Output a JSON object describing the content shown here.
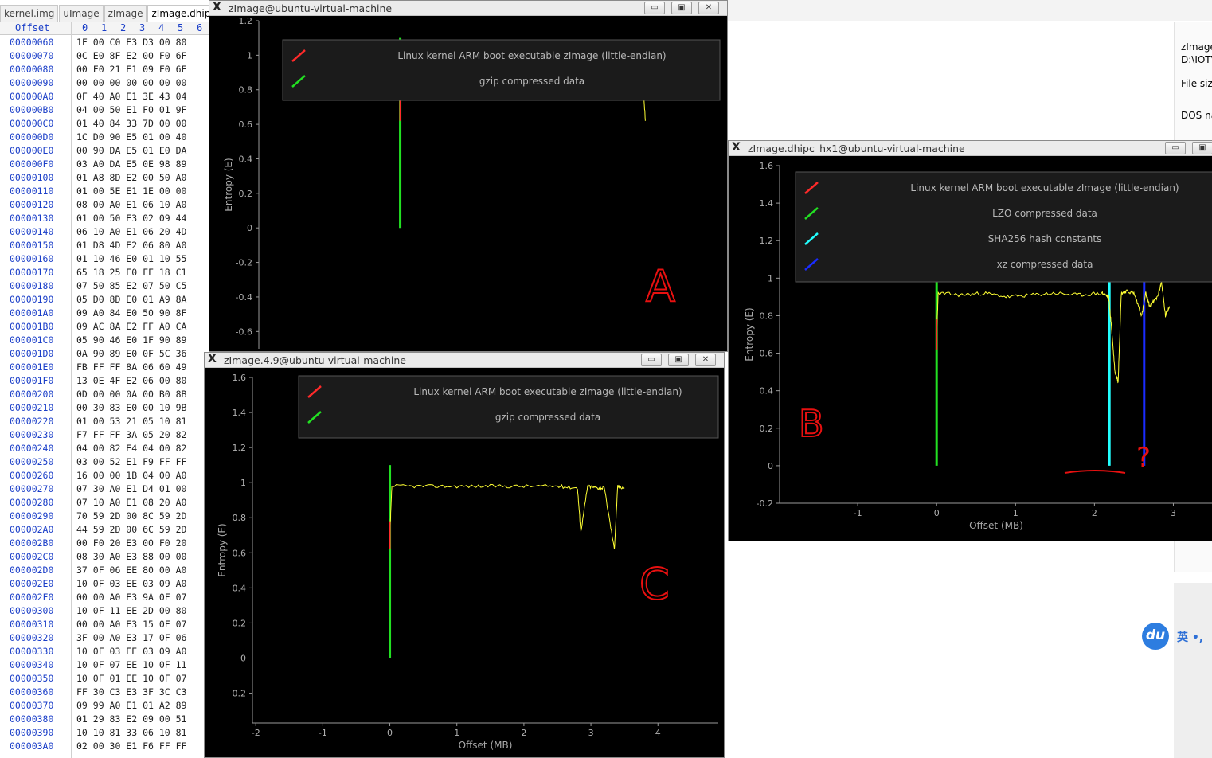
{
  "hex_editor": {
    "tabs": [
      "kernel.img",
      "uImage",
      "zImage",
      "zImage.dhip"
    ],
    "offset_header": "Offset",
    "columns": [
      "0",
      "1",
      "2",
      "3",
      "4",
      "5",
      "6"
    ],
    "rows": [
      {
        "addr": "00000060",
        "bytes": "1F 00 C0 E3 D3 00 80"
      },
      {
        "addr": "00000070",
        "bytes": "0C E0 8F E2 00 F0 6F"
      },
      {
        "addr": "00000080",
        "bytes": "00 F0 21 E1 09 F0 6F"
      },
      {
        "addr": "00000090",
        "bytes": "00 00 00 00 00 00 00"
      },
      {
        "addr": "000000A0",
        "bytes": "0F 40 A0 E1 3E 43 04"
      },
      {
        "addr": "000000B0",
        "bytes": "04 00 50 E1 F0 01 9F"
      },
      {
        "addr": "000000C0",
        "bytes": "01 40 84 33 7D 00 00"
      },
      {
        "addr": "000000D0",
        "bytes": "1C D0 90 E5 01 00 40"
      },
      {
        "addr": "000000E0",
        "bytes": "00 90 DA E5 01 E0 DA"
      },
      {
        "addr": "000000F0",
        "bytes": "03 A0 DA E5 0E 98 89"
      },
      {
        "addr": "00000100",
        "bytes": "01 A8 8D E2 00 50 A0"
      },
      {
        "addr": "00000110",
        "bytes": "01 00 5E E1 1E 00 00"
      },
      {
        "addr": "00000120",
        "bytes": "08 00 A0 E1 06 10 A0"
      },
      {
        "addr": "00000130",
        "bytes": "01 00 50 E3 02 09 44"
      },
      {
        "addr": "00000140",
        "bytes": "06 10 A0 E1 06 20 4D"
      },
      {
        "addr": "00000150",
        "bytes": "01 D8 4D E2 06 80 A0"
      },
      {
        "addr": "00000160",
        "bytes": "01 10 46 E0 01 10 55"
      },
      {
        "addr": "00000170",
        "bytes": "65 18 25 E0 FF 18 C1"
      },
      {
        "addr": "00000180",
        "bytes": "07 50 85 E2 07 50 C5"
      },
      {
        "addr": "00000190",
        "bytes": "05 D0 8D E0 01 A9 8A"
      },
      {
        "addr": "000001A0",
        "bytes": "09 A0 84 E0 50 90 8F"
      },
      {
        "addr": "000001B0",
        "bytes": "09 AC 8A E2 FF A0 CA"
      },
      {
        "addr": "000001C0",
        "bytes": "05 90 46 E0 1F 90 89"
      },
      {
        "addr": "000001D0",
        "bytes": "0A 90 89 E0 0F 5C 36"
      },
      {
        "addr": "000001E0",
        "bytes": "FB FF FF 8A 06 60 49"
      },
      {
        "addr": "000001F0",
        "bytes": "13 0E 4F E2 06 00 80"
      },
      {
        "addr": "00000200",
        "bytes": "0D 00 00 0A 00 B0 8B"
      },
      {
        "addr": "00000210",
        "bytes": "00 30 83 E0 00 10 9B"
      },
      {
        "addr": "00000220",
        "bytes": "01 00 53 21 05 10 81"
      },
      {
        "addr": "00000230",
        "bytes": "F7 FF FF 3A 05 20 82"
      },
      {
        "addr": "00000240",
        "bytes": "04 00 82 E4 04 00 82"
      },
      {
        "addr": "00000250",
        "bytes": "03 00 52 E1 F9 FF FF"
      },
      {
        "addr": "00000260",
        "bytes": "16 00 00 1B 04 00 A0"
      },
      {
        "addr": "00000270",
        "bytes": "07 30 A0 E1 D4 01 00"
      },
      {
        "addr": "00000280",
        "bytes": "07 10 A0 E1 08 20 A0"
      },
      {
        "addr": "00000290",
        "bytes": "70 59 2D 00 8C 59 2D"
      },
      {
        "addr": "000002A0",
        "bytes": "44 59 2D 00 6C 59 2D"
      },
      {
        "addr": "000002B0",
        "bytes": "00 F0 20 E3 00 F0 20"
      },
      {
        "addr": "000002C0",
        "bytes": "08 30 A0 E3 88 00 00"
      },
      {
        "addr": "000002D0",
        "bytes": "37 0F 06 EE 80 00 A0"
      },
      {
        "addr": "000002E0",
        "bytes": "10 0F 03 EE 03 09 A0"
      },
      {
        "addr": "000002F0",
        "bytes": "00 00 A0 E3 9A 0F 07"
      },
      {
        "addr": "00000300",
        "bytes": "10 0F 11 EE 2D 00 80"
      },
      {
        "addr": "00000310",
        "bytes": "00 00 A0 E3 15 0F 07"
      },
      {
        "addr": "00000320",
        "bytes": "3F 00 A0 E3 17 0F 06"
      },
      {
        "addr": "00000330",
        "bytes": "10 0F 03 EE 03 09 A0"
      },
      {
        "addr": "00000340",
        "bytes": "10 0F 07 EE 10 0F 11"
      },
      {
        "addr": "00000350",
        "bytes": "10 0F 01 EE 10 0F 07"
      },
      {
        "addr": "00000360",
        "bytes": "FF 30 C3 E3 3F 3C C3"
      },
      {
        "addr": "00000370",
        "bytes": "09 99 A0 E1 01 A2 89"
      },
      {
        "addr": "00000380",
        "bytes": "01 29 83 E2 09 00 51"
      },
      {
        "addr": "00000390",
        "bytes": "10 10 81 33 06 10 81"
      },
      {
        "addr": "000003A0",
        "bytes": "02 00 30 E1 F6 FF FF"
      }
    ]
  },
  "properties": {
    "name_line1": "zImage",
    "name_line2": "D:\\IOTV",
    "file_size_label": "File size",
    "dos_label": "DOS na"
  },
  "ime": {
    "logo": "du",
    "text": "英 •,"
  },
  "colors": {
    "red": "#ff2a2a",
    "green": "#22e022",
    "cyan": "#22ffff",
    "blue": "#1a2cff",
    "yellow": "#ffff33",
    "plot_bg": "#000000",
    "legend_bg": "#1b1b1b"
  },
  "windows": {
    "A": {
      "title": "zImage@ubuntu-virtual-machine",
      "buttons": [
        "▭",
        "▣",
        "✕"
      ],
      "ylabel": "Entropy (E)",
      "legend": [
        "Linux kernel ARM boot executable zImage (little-endian)",
        "gzip compressed data"
      ],
      "annotation": "A"
    },
    "B": {
      "title": "zImage.dhipc_hx1@ubuntu-virtual-machine",
      "buttons": [
        "▭",
        "▣"
      ],
      "ylabel": "Entropy (E)",
      "xlabel": "Offset (MB)",
      "legend": [
        "Linux kernel ARM boot executable zImage (little-endian)",
        "LZO compressed data",
        "SHA256 hash constants",
        "xz compressed data"
      ],
      "annotation": "B",
      "annotation2": "?"
    },
    "C": {
      "title": "zImage.4.9@ubuntu-virtual-machine",
      "buttons": [
        "▭",
        "▣",
        "✕"
      ],
      "ylabel": "Entropy (E)",
      "xlabel": "Offset (MB)",
      "legend": [
        "Linux kernel ARM boot executable zImage (little-endian)",
        "gzip compressed data"
      ],
      "annotation": "C"
    }
  },
  "chart_data": [
    {
      "type": "line",
      "title": "",
      "ylabel": "Entropy (E)",
      "xlabel": "",
      "ylim": [
        -0.7,
        1.2
      ],
      "yticks": [
        1.2,
        1,
        0.8,
        0.6,
        0.4,
        0.2,
        0,
        -0.2,
        -0.4,
        -0.6
      ],
      "grid": false,
      "legend_placement": "top",
      "series": [
        {
          "name": "Linux kernel ARM boot executable zImage (little-endian)",
          "kind": "vline",
          "x": 0,
          "color": "#ff2a2a"
        },
        {
          "name": "gzip compressed data",
          "kind": "vline",
          "x": 0,
          "y": [
            0,
            1.1
          ],
          "color": "#22e022"
        },
        {
          "kind": "entropy",
          "color": "#ffff33",
          "x": [
            0,
            0.02,
            0.5,
            1.0,
            1.5,
            2.0,
            2.6,
            2.7,
            2.8,
            2.9,
            3.0,
            3.3,
            3.4,
            3.45
          ],
          "y": [
            0.7,
            0.98,
            0.98,
            0.98,
            0.98,
            0.98,
            0.98,
            0.9,
            0.97,
            0.95,
            0.97,
            0.93,
            0.97,
            0.62
          ]
        }
      ]
    },
    {
      "type": "line",
      "title": "",
      "ylabel": "Entropy (E)",
      "xlabel": "Offset (MB)",
      "ylim": [
        -0.2,
        1.6
      ],
      "yticks": [
        1.6,
        1.4,
        1.2,
        1,
        0.8,
        0.6,
        0.4,
        0.2,
        0,
        -0.2
      ],
      "xticks": [
        -1,
        0,
        1,
        2,
        3
      ],
      "grid": false,
      "legend_placement": "top",
      "series": [
        {
          "name": "Linux kernel ARM boot executable zImage (little-endian)",
          "kind": "vline",
          "x": 0,
          "color": "#ff2a2a"
        },
        {
          "name": "LZO compressed data",
          "kind": "vline",
          "x": 0,
          "y": [
            0,
            1.1
          ],
          "color": "#22e022"
        },
        {
          "name": "SHA256 hash constants",
          "kind": "vline",
          "x": 2.19,
          "y": [
            0,
            1.1
          ],
          "color": "#22ffff"
        },
        {
          "name": "xz compressed data",
          "kind": "vline",
          "x": 2.63,
          "y": [
            0,
            1.1
          ],
          "color": "#1a2cff"
        },
        {
          "kind": "entropy",
          "color": "#ffff33",
          "x": [
            0,
            0.02,
            0.3,
            0.6,
            0.9,
            1.2,
            1.5,
            1.8,
            2.1,
            2.18,
            2.22,
            2.26,
            2.3,
            2.34,
            2.4,
            2.5,
            2.6,
            2.65,
            2.7,
            2.8,
            2.85,
            2.9,
            2.95
          ],
          "y": [
            0.7,
            0.92,
            0.91,
            0.92,
            0.9,
            0.91,
            0.92,
            0.91,
            0.92,
            0.9,
            0.72,
            0.5,
            0.45,
            0.92,
            0.93,
            0.92,
            0.8,
            0.92,
            0.85,
            0.9,
            0.98,
            0.8,
            0.85
          ]
        }
      ]
    },
    {
      "type": "line",
      "title": "",
      "ylabel": "Entropy (E)",
      "xlabel": "Offset (MB)",
      "ylim": [
        -0.37,
        1.6
      ],
      "yticks": [
        1.6,
        1.4,
        1.2,
        1,
        0.8,
        0.6,
        0.4,
        0.2,
        0,
        -0.2
      ],
      "xticks": [
        -2,
        -1,
        0,
        1,
        2,
        3,
        4
      ],
      "grid": false,
      "legend_placement": "top",
      "series": [
        {
          "name": "Linux kernel ARM boot executable zImage (little-endian)",
          "kind": "vline",
          "x": 0,
          "color": "#ff2a2a"
        },
        {
          "name": "gzip compressed data",
          "kind": "vline",
          "x": 0,
          "y": [
            0,
            1.1
          ],
          "color": "#22e022"
        },
        {
          "kind": "entropy",
          "color": "#ffff33",
          "x": [
            0,
            0.03,
            0.5,
            1.0,
            1.5,
            2.0,
            2.5,
            2.8,
            2.85,
            2.95,
            3.1,
            3.2,
            3.35,
            3.4,
            3.5
          ],
          "y": [
            0.7,
            0.98,
            0.98,
            0.98,
            0.98,
            0.98,
            0.98,
            0.97,
            0.72,
            0.98,
            0.97,
            0.97,
            0.62,
            0.98,
            0.97
          ]
        }
      ]
    }
  ]
}
